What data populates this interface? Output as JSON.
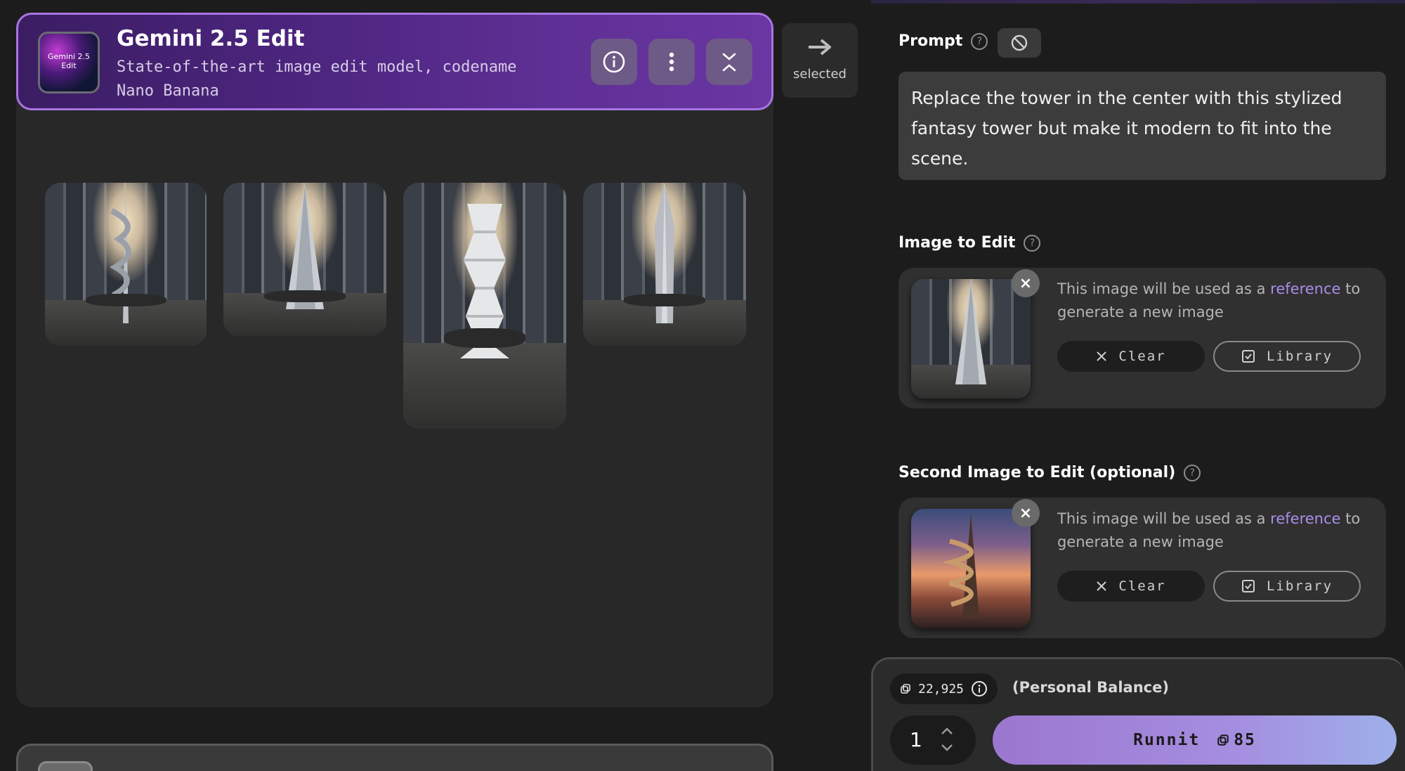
{
  "model": {
    "thumb_text": "Gemini 2.5 Edit",
    "title": "Gemini 2.5 Edit",
    "description": "State-of-the-art image edit model, codename Nano Banana"
  },
  "selected_label": "selected",
  "prompt": {
    "label": "Prompt",
    "help": "?",
    "text": "Replace the tower in the center with this stylized fantasy tower but make it modern to fit into the scene."
  },
  "image_to_edit": {
    "label": "Image to Edit",
    "help": "?",
    "desc_prefix": "This image will be used as a ",
    "desc_link": "reference",
    "desc_suffix": " to generate a new image",
    "clear_label": "Clear",
    "library_label": "Library",
    "close": "×"
  },
  "second_image": {
    "label": "Second Image to Edit (optional)",
    "help": "?",
    "desc_prefix": "This image will be used as a ",
    "desc_link": "reference",
    "desc_suffix": " to generate a new image",
    "clear_label": "Clear",
    "library_label": "Library",
    "close": "×"
  },
  "footer": {
    "balance": "22,925",
    "balance_label": "(Personal Balance)",
    "quantity": "1",
    "run_label": "Runnit",
    "run_cost": "85"
  },
  "colors": {
    "accent": "#a775e2",
    "link": "#a98fe8"
  }
}
